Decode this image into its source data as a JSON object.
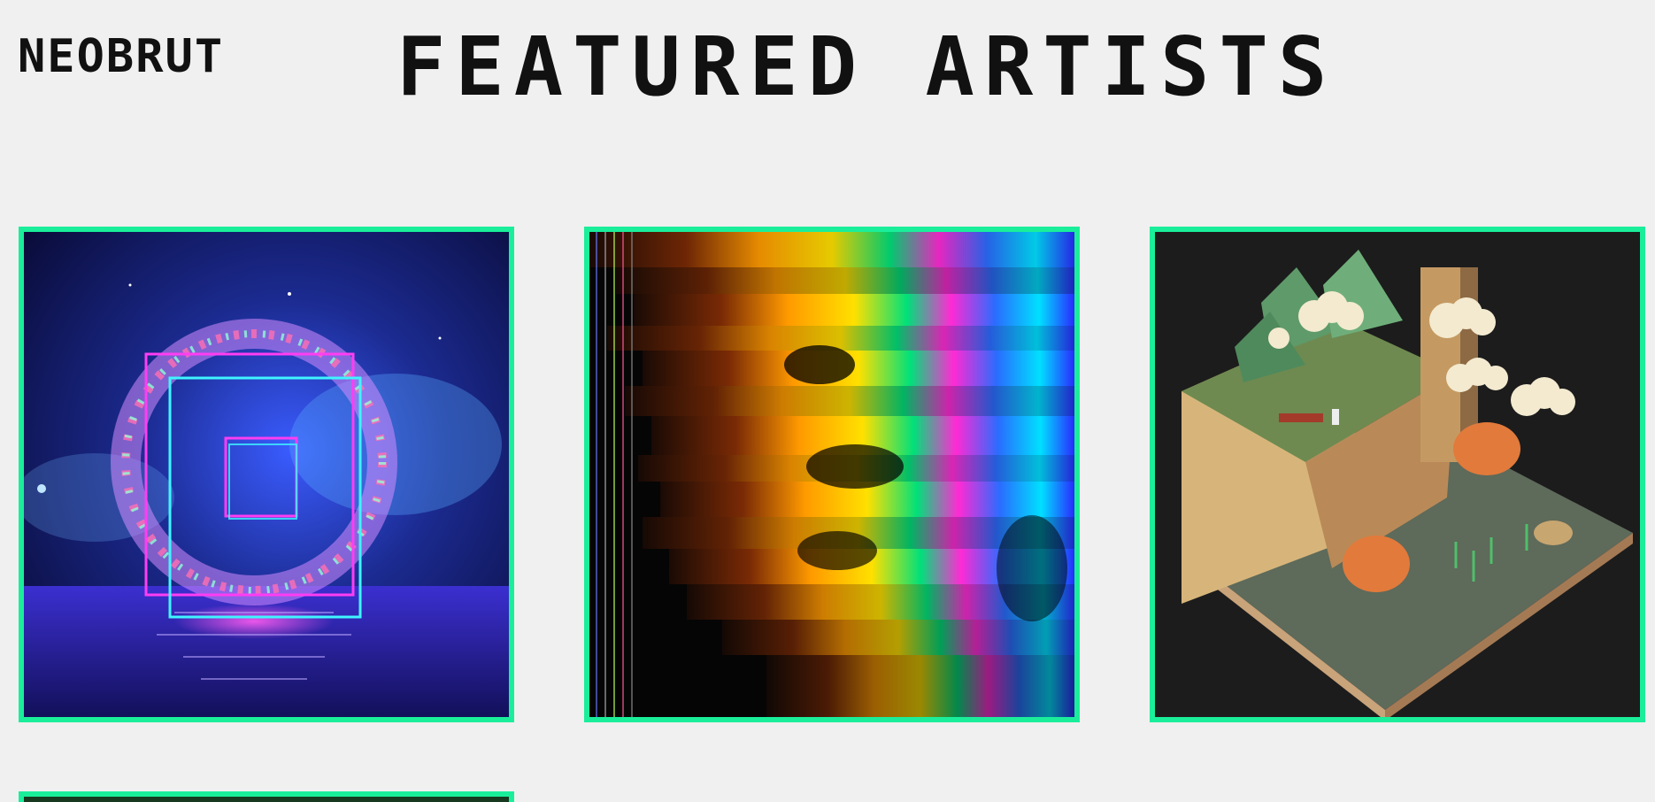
{
  "brand": {
    "name": "NEOBRUT"
  },
  "section": {
    "title": "FEATURED ARTISTS"
  },
  "colors": {
    "background": "#f0f0f0",
    "card_border": "#1aee9a",
    "text": "#111111"
  },
  "artworks": [
    {
      "icon": "neon-floral-square-artwork"
    },
    {
      "icon": "glitch-rainbow-face-artwork"
    },
    {
      "icon": "voxel-island-artwork"
    },
    {
      "icon": "forest-artwork-partial"
    }
  ]
}
